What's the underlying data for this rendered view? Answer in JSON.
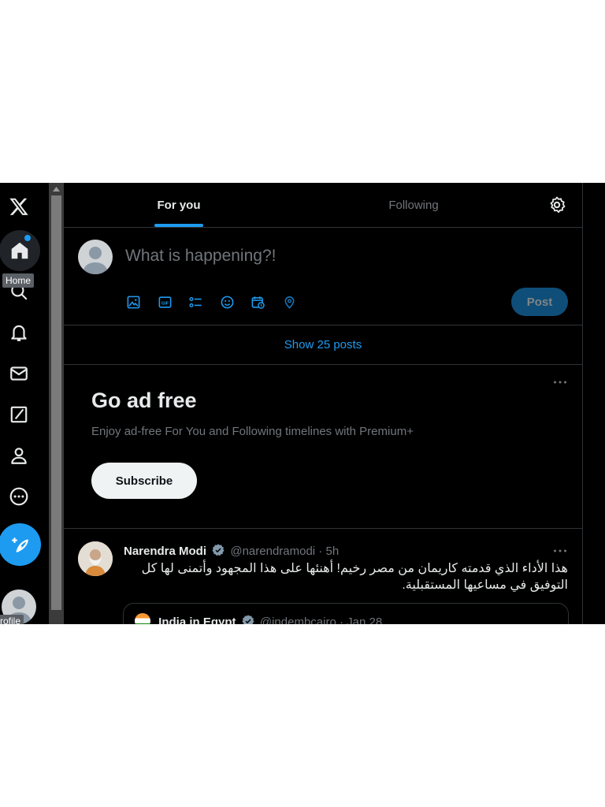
{
  "app": {
    "logo": "x-logo-icon"
  },
  "nav": {
    "items": [
      {
        "name": "home",
        "icon": "home-icon"
      },
      {
        "name": "explore",
        "icon": "search-icon"
      },
      {
        "name": "notifications",
        "icon": "bell-icon"
      },
      {
        "name": "messages",
        "icon": "mail-icon"
      },
      {
        "name": "grok",
        "icon": "grok-icon"
      },
      {
        "name": "profile",
        "icon": "person-icon"
      },
      {
        "name": "more",
        "icon": "more-circle-icon"
      }
    ],
    "home_tooltip": "Home",
    "profile_tooltip": "Profile"
  },
  "tabs": [
    {
      "label": "For you",
      "active": true
    },
    {
      "label": "Following",
      "active": false
    }
  ],
  "composer": {
    "placeholder": "What is happening?!",
    "tools": [
      "image-icon",
      "gif-icon",
      "poll-icon",
      "emoji-icon",
      "schedule-icon",
      "location-icon"
    ],
    "post_label": "Post"
  },
  "show_posts": "Show 25 posts",
  "ad": {
    "title": "Go ad free",
    "subtitle": "Enjoy ad-free For You and Following timelines with Premium+",
    "button": "Subscribe"
  },
  "tweet": {
    "name": "Narendra Modi",
    "handle": "@narendramodi",
    "separator": "·",
    "time": "5h",
    "text": "هذا الأداء الذي قدمته كاريمان من مصر رخيم! أهنئها على هذا المجهود وأتمنى لها كل التوفيق في مساعيها المستقبلية.",
    "quote": {
      "name": "India in Egypt",
      "handle": "@indembcairo",
      "time": "Jan 28"
    }
  },
  "colors": {
    "accent": "#1d9bf0",
    "background": "#000000",
    "border": "#2f3336",
    "muted": "#71767b"
  }
}
